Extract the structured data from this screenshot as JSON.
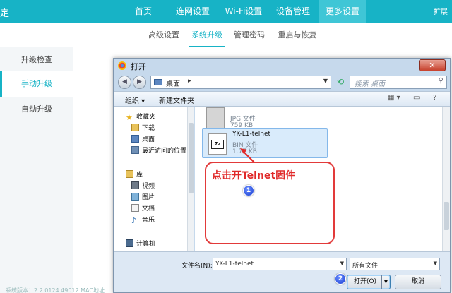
{
  "topnav": {
    "brand": "定",
    "items": [
      "首页",
      "连网设置",
      "Wi-Fi设置",
      "设备管理",
      "更多设置"
    ],
    "right": "扩展"
  },
  "subnav": {
    "items": [
      "高级设置",
      "系统升级",
      "管理密码",
      "重启与恢复"
    ]
  },
  "sidemenu": {
    "items": [
      "升级检查",
      "手动升级",
      "自动升级"
    ]
  },
  "footer": "系统版本：2.2.0124.49012    MAC地址",
  "dialog": {
    "title": "打开",
    "close_glyph": "✕",
    "address": {
      "crumb": "桌面",
      "arrow": "▸"
    },
    "search_placeholder": "搜索 桌面",
    "toolbar": {
      "organize": "组织 ▾",
      "new_folder": "新建文件夹"
    },
    "left_pane": {
      "items": [
        "收藏夹",
        "下载",
        "桌面",
        "最近访问的位置",
        "库",
        "视频",
        "图片",
        "文档",
        "音乐",
        "计算机"
      ]
    },
    "files": [
      {
        "name": "",
        "type": "JPG 文件",
        "size": "759 KB",
        "icon_label": ""
      },
      {
        "name": "YK-L1-telnet",
        "type": "BIN 文件",
        "size": "1.77 KB",
        "icon_label": "7z"
      }
    ],
    "filename_label": "文件名(N):",
    "filename_value": "YK-L1-telnet",
    "filetype_value": "所有文件",
    "open_button": "打开(O)",
    "cancel_button": "取消"
  },
  "annotations": {
    "callout_text": "点击开Telnet固件",
    "badge1": "1",
    "badge2": "2"
  }
}
